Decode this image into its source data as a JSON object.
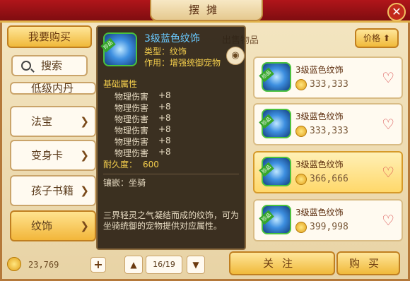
{
  "window": {
    "title": "摆摊",
    "close_label": "✕"
  },
  "left": {
    "buy_tab": "我要购买",
    "search_label": "搜索",
    "categories": [
      {
        "label": "低级内丹"
      },
      {
        "label": "法宝"
      },
      {
        "label": "变身卡"
      },
      {
        "label": "孩子书籍"
      },
      {
        "label": "纹饰"
      }
    ]
  },
  "faint_tab": "出售物品",
  "sort": {
    "label": "价格",
    "arrow": "⬆"
  },
  "list": {
    "items": [
      {
        "name": "3级蓝色纹饰",
        "price": "333,333"
      },
      {
        "name": "3级蓝色纹饰",
        "price": "333,333"
      },
      {
        "name": "3级蓝色纹饰",
        "price": "366,666"
      },
      {
        "name": "3级蓝色纹饰",
        "price": "399,998"
      }
    ],
    "gem_tag": "珍品"
  },
  "popup": {
    "name": "3级蓝色纹饰",
    "gem_tag": "珍品",
    "type": "类型：纹饰",
    "use": "作用：增强统御宠物",
    "section": "基础属性",
    "stats": [
      {
        "label": "物理伤害",
        "value": "+8"
      },
      {
        "label": "物理伤害",
        "value": "+8"
      },
      {
        "label": "物理伤害",
        "value": "+8"
      },
      {
        "label": "物理伤害",
        "value": "+8"
      },
      {
        "label": "物理伤害",
        "value": "+8"
      },
      {
        "label": "物理伤害",
        "value": "+8"
      }
    ],
    "durability_label": "耐久度：",
    "durability_value": "600",
    "inlay": "镶嵌：坐骑",
    "description": "三界轻灵之气凝结而成的纹饰，可为坐骑统御的宠物提供对应属性。"
  },
  "bottom": {
    "money": "23,769",
    "plus": "+",
    "prev": "▲",
    "next": "▼",
    "page": "16/19",
    "follow": "关注",
    "buy": "购买"
  },
  "colors": {
    "accent": "#f0b93a",
    "name_blue": "#69c9ff",
    "attr_yellow": "#f6d04d",
    "heart": "#d94d4d"
  }
}
